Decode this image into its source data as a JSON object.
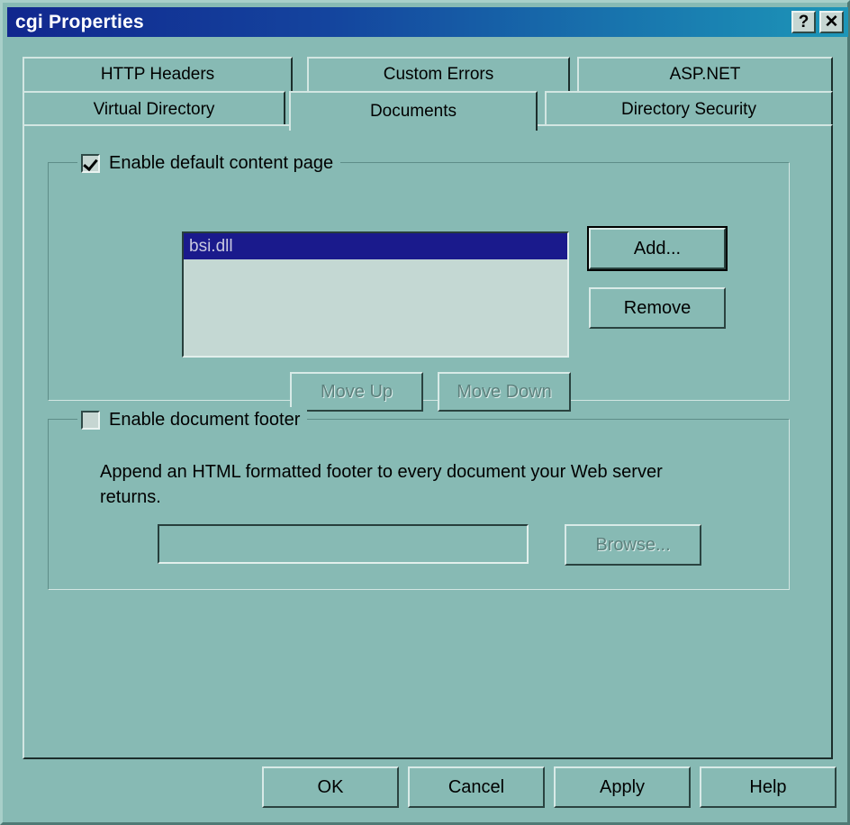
{
  "window": {
    "title": "cgi Properties",
    "help_button": "?",
    "close_button": "✕",
    "help_icon_name": "help-icon",
    "close_icon_name": "close-icon",
    "bg_color": "#87bab4",
    "titlebar_gradient_start": "#11278e",
    "titlebar_gradient_end": "#1d96b8"
  },
  "tabs": {
    "row1": [
      {
        "label": "HTTP Headers",
        "selected": false
      },
      {
        "label": "Custom Errors",
        "selected": false
      },
      {
        "label": "ASP.NET",
        "selected": false
      }
    ],
    "row2": [
      {
        "label": "Virtual Directory",
        "selected": false
      },
      {
        "label": "Documents",
        "selected": true
      },
      {
        "label": "Directory Security",
        "selected": false
      }
    ],
    "active": "Documents"
  },
  "default_content_group": {
    "legend": "Enable default content page",
    "checked": true,
    "list_items": [
      {
        "label": "bsi.dll",
        "selected": true
      }
    ],
    "buttons": {
      "add": "Add...",
      "remove": "Remove",
      "move_up": "Move Up",
      "move_down": "Move Down"
    },
    "states": {
      "add_default": true,
      "move_up_disabled": true,
      "move_down_disabled": true
    }
  },
  "document_footer_group": {
    "legend": "Enable document footer",
    "checked": false,
    "description": "Append an HTML formatted footer to every document your Web server returns.",
    "path_value": "",
    "path_placeholder": "",
    "browse_label": "Browse...",
    "browse_disabled": true
  },
  "actions": {
    "ok": "OK",
    "cancel": "Cancel",
    "apply": "Apply",
    "help": "Help"
  },
  "colors": {
    "dialog_face": "#87bab4",
    "list_face": "#c4d8d3",
    "selection": "#1a1a8c",
    "selection_text": "#c8c8e0",
    "disabled_text": "#5d817d"
  }
}
